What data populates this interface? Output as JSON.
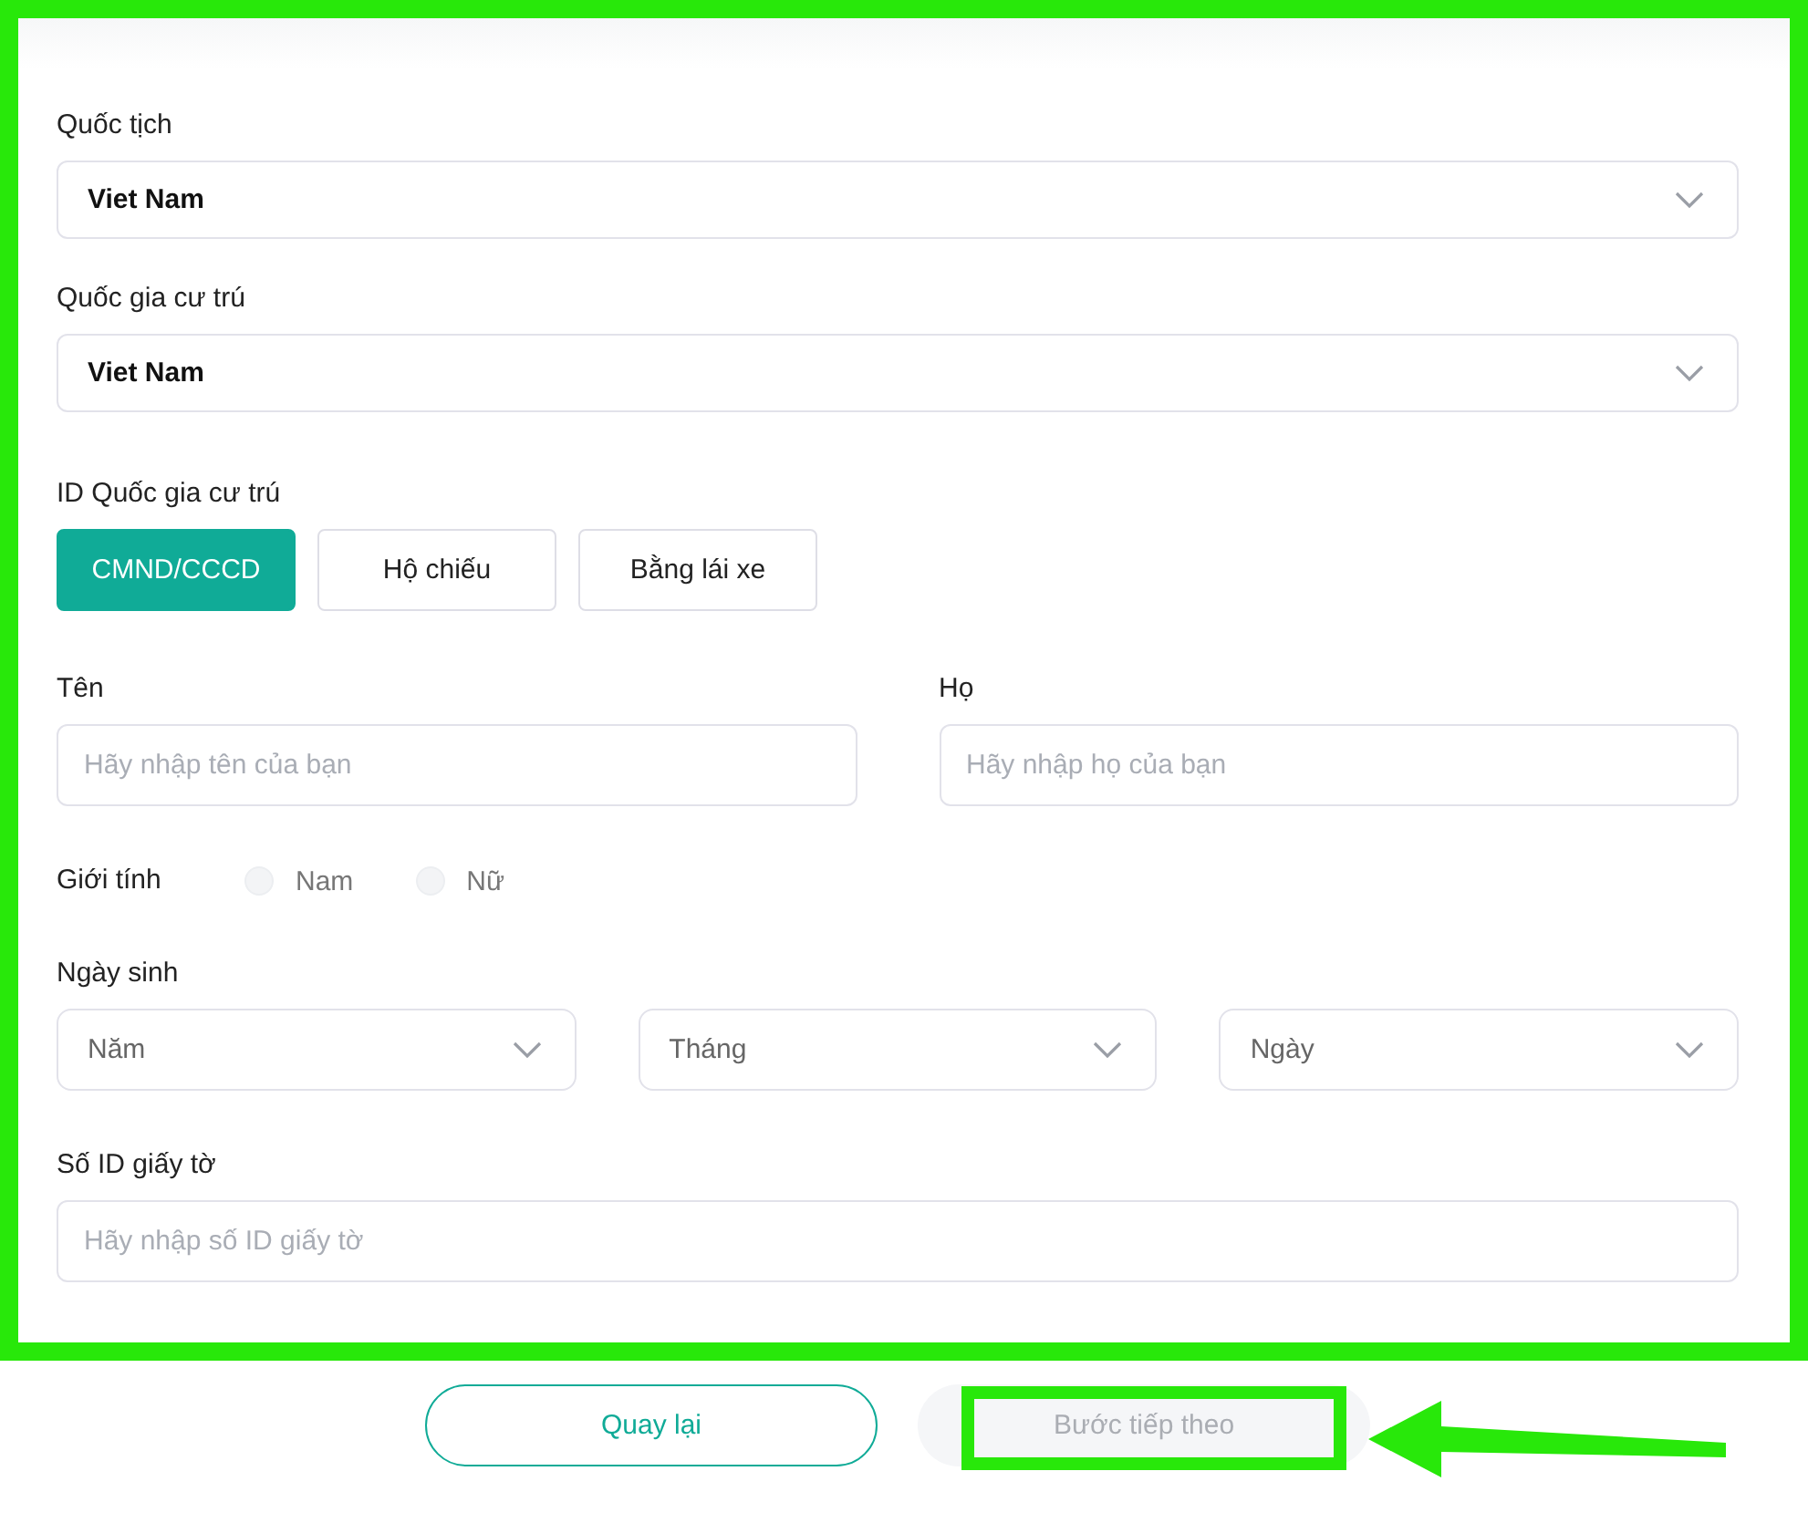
{
  "nationality": {
    "label": "Quốc tịch",
    "value": "Viet Nam"
  },
  "residence_country": {
    "label": "Quốc gia cư trú",
    "value": "Viet Nam"
  },
  "id_type": {
    "label": "ID Quốc gia cư trú",
    "options": [
      {
        "label": "CMND/CCCD",
        "selected": true
      },
      {
        "label": "Hộ chiếu",
        "selected": false
      },
      {
        "label": "Bằng lái xe",
        "selected": false
      }
    ]
  },
  "first_name": {
    "label": "Tên",
    "placeholder": "Hãy nhập tên của bạn"
  },
  "last_name": {
    "label": "Họ",
    "placeholder": "Hãy nhập họ của bạn"
  },
  "gender": {
    "label": "Giới tính",
    "options": [
      {
        "label": "Nam",
        "selected": false
      },
      {
        "label": "Nữ",
        "selected": false
      }
    ]
  },
  "birth_date": {
    "label": "Ngày sinh",
    "selects": [
      "Năm",
      "Tháng",
      "Ngày"
    ]
  },
  "id_number": {
    "label": "Số ID giấy tờ",
    "placeholder": "Hãy nhập số ID giấy tờ"
  },
  "buttons": [
    {
      "label": "Quay lại",
      "kind": "back",
      "disabled": false
    },
    {
      "label": "Bước tiếp theo",
      "kind": "next",
      "disabled": true
    }
  ]
}
